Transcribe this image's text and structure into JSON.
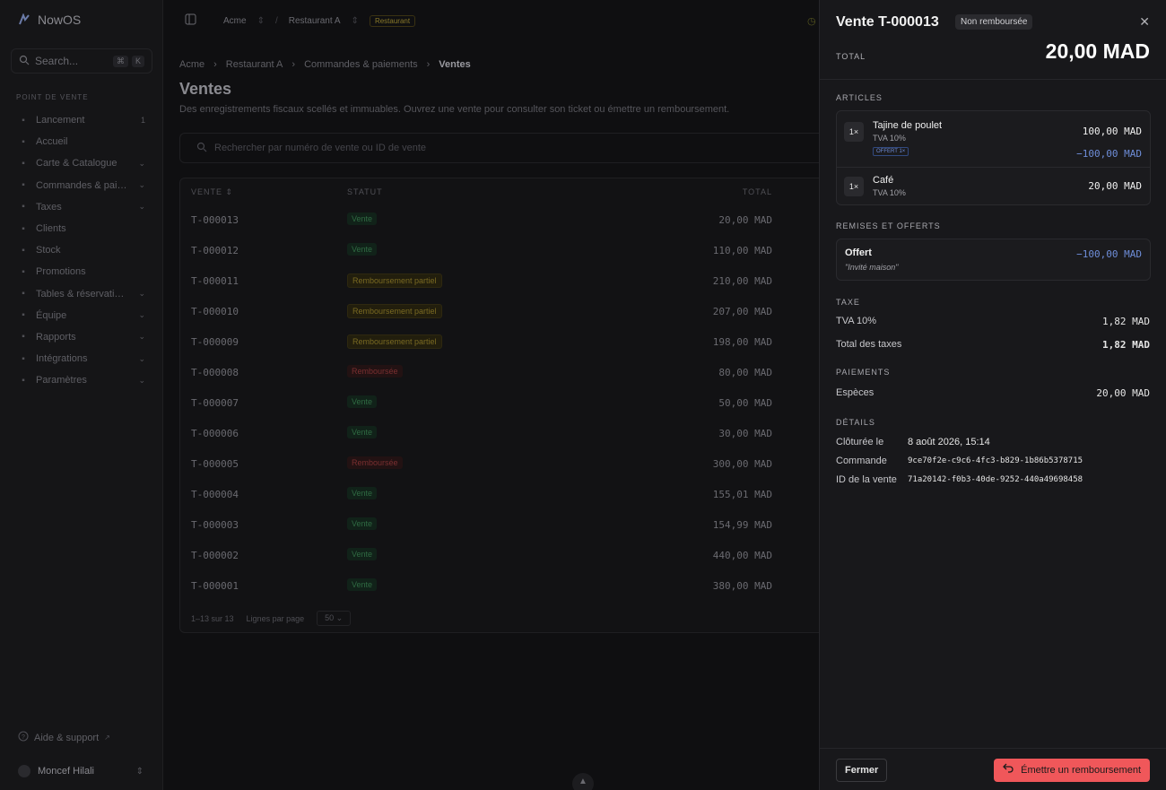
{
  "app": {
    "name": "NowOS"
  },
  "sidebar": {
    "search_label": "Search...",
    "kbd": [
      "⌘",
      "K"
    ],
    "section_label": "POINT DE VENTE",
    "items": [
      {
        "label": "Lancement",
        "icon": "rocket-icon",
        "badge": "1"
      },
      {
        "label": "Accueil",
        "icon": "home-icon"
      },
      {
        "label": "Carte & Catalogue",
        "icon": "catalog-icon",
        "chevron": true
      },
      {
        "label": "Commandes & pai…",
        "icon": "orders-icon",
        "chevron": true
      },
      {
        "label": "Taxes",
        "icon": "percent-icon",
        "chevron": true
      },
      {
        "label": "Clients",
        "icon": "users-icon"
      },
      {
        "label": "Stock",
        "icon": "box-icon"
      },
      {
        "label": "Promotions",
        "icon": "tag-icon"
      },
      {
        "label": "Tables & réservati…",
        "icon": "table-icon",
        "chevron": true
      },
      {
        "label": "Équipe",
        "icon": "team-icon",
        "chevron": true
      },
      {
        "label": "Rapports",
        "icon": "chart-icon",
        "chevron": true
      },
      {
        "label": "Intégrations",
        "icon": "plug-icon",
        "chevron": true
      },
      {
        "label": "Paramètres",
        "icon": "gear-icon",
        "chevron": true
      }
    ],
    "help_label": "Aide & support",
    "user_name": "Moncef Hilali"
  },
  "topbar": {
    "org": "Acme",
    "restaurant": "Restaurant A",
    "tag": "Restaurant"
  },
  "main": {
    "breadcrumb": [
      "Acme",
      "Restaurant A",
      "Commandes & paiements",
      "Ventes"
    ],
    "title": "Ventes",
    "description": "Des enregistrements fiscaux scellés et immuables. Ouvrez une vente pour consulter son ticket ou émettre un remboursement.",
    "search_placeholder": "Rechercher par numéro de vente ou ID de vente",
    "columns": {
      "vente": "VENTE",
      "statut": "STATUT",
      "total": "TOTAL"
    },
    "rows": [
      {
        "id": "T-000013",
        "status": "Vente",
        "kind": "vente",
        "total": "20,00 MAD"
      },
      {
        "id": "T-000012",
        "status": "Vente",
        "kind": "vente",
        "total": "110,00 MAD"
      },
      {
        "id": "T-000011",
        "status": "Remboursement partiel",
        "kind": "partiel",
        "total": "210,00 MAD"
      },
      {
        "id": "T-000010",
        "status": "Remboursement partiel",
        "kind": "partiel",
        "total": "207,00 MAD"
      },
      {
        "id": "T-000009",
        "status": "Remboursement partiel",
        "kind": "partiel",
        "total": "198,00 MAD"
      },
      {
        "id": "T-000008",
        "status": "Remboursée",
        "kind": "rembourse",
        "total": "80,00 MAD"
      },
      {
        "id": "T-000007",
        "status": "Vente",
        "kind": "vente",
        "total": "50,00 MAD"
      },
      {
        "id": "T-000006",
        "status": "Vente",
        "kind": "vente",
        "total": "30,00 MAD"
      },
      {
        "id": "T-000005",
        "status": "Remboursée",
        "kind": "rembourse",
        "total": "300,00 MAD"
      },
      {
        "id": "T-000004",
        "status": "Vente",
        "kind": "vente",
        "total": "155,01 MAD"
      },
      {
        "id": "T-000003",
        "status": "Vente",
        "kind": "vente",
        "total": "154,99 MAD"
      },
      {
        "id": "T-000002",
        "status": "Vente",
        "kind": "vente",
        "total": "440,00 MAD"
      },
      {
        "id": "T-000001",
        "status": "Vente",
        "kind": "vente",
        "total": "380,00 MAD"
      }
    ],
    "pagination": "1–13 sur 13",
    "rows_per_page_label": "Lignes par page",
    "rows_per_page_value": "50"
  },
  "drawer": {
    "title": "Vente T-000013",
    "status": "Non remboursée",
    "total_label": "TOTAL",
    "total_value": "20,00 MAD",
    "articles_label": "ARTICLES",
    "items": [
      {
        "qty": "1×",
        "name": "Tajine de poulet",
        "tax": "TVA 10%",
        "price": "100,00 MAD",
        "offer_tag": "OFFERT 1×",
        "discount": "−100,00 MAD"
      },
      {
        "qty": "1×",
        "name": "Café",
        "tax": "TVA 10%",
        "price": "20,00 MAD"
      }
    ],
    "discounts_label": "REMISES ET OFFERTS",
    "discount": {
      "name": "Offert",
      "note": "\"Invité maison\"",
      "amount": "−100,00 MAD"
    },
    "tax_label": "TAXE",
    "tax_rows": [
      {
        "label": "TVA 10%",
        "value": "1,82 MAD"
      },
      {
        "label": "Total des taxes",
        "value": "1,82 MAD"
      }
    ],
    "payments_label": "PAIEMENTS",
    "payment": {
      "label": "Espèces",
      "value": "20,00 MAD"
    },
    "details_label": "DÉTAILS",
    "details": [
      {
        "label": "Clôturée le",
        "value": "8 août 2026, 15:14"
      },
      {
        "label": "Commande",
        "value": "9ce70f2e-c9c6-4fc3-b829-1b86b5378715"
      },
      {
        "label": "ID de la vente",
        "value": "71a20142-f0b3-40de-9252-440a49698458"
      }
    ],
    "close_button": "Fermer",
    "refund_button": "Émettre un remboursement"
  }
}
